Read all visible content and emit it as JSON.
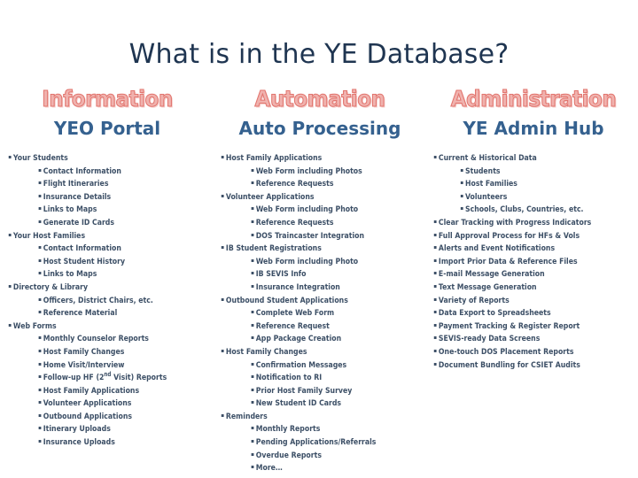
{
  "slide": {
    "title": "What is in the YE Database?"
  },
  "columns": [
    {
      "banner": "Information",
      "sub_header": "YEO Portal",
      "items": [
        {
          "level": 1,
          "text": "Your Students"
        },
        {
          "level": 2,
          "text": "Contact Information"
        },
        {
          "level": 2,
          "text": "Flight Itineraries"
        },
        {
          "level": 2,
          "text": "Insurance Details"
        },
        {
          "level": 2,
          "text": "Links to Maps"
        },
        {
          "level": 2,
          "text": "Generate ID Cards"
        },
        {
          "level": 1,
          "text": "Your Host Families"
        },
        {
          "level": 2,
          "text": "Contact Information"
        },
        {
          "level": 2,
          "text": "Host Student History"
        },
        {
          "level": 2,
          "text": "Links to Maps"
        },
        {
          "level": 1,
          "text": "Directory & Library"
        },
        {
          "level": 2,
          "text": "Officers, District Chairs, etc."
        },
        {
          "level": 2,
          "text": "Reference Material"
        },
        {
          "level": 1,
          "text": "Web Forms"
        },
        {
          "level": 2,
          "text": "Monthly Counselor Reports"
        },
        {
          "level": 2,
          "text": "Host Family Changes"
        },
        {
          "level": 2,
          "text": "Home Visit/Interview"
        },
        {
          "level": 2,
          "text": "Follow-up HF (2nd Visit) Reports",
          "superscript": {
            "before": "Follow-up HF (2",
            "sup": "nd",
            "after": " Visit) Reports"
          }
        },
        {
          "level": 2,
          "text": "Host Family Applications"
        },
        {
          "level": 2,
          "text": "Volunteer Applications"
        },
        {
          "level": 2,
          "text": "Outbound Applications"
        },
        {
          "level": 2,
          "text": "Itinerary Uploads"
        },
        {
          "level": 2,
          "text": "Insurance Uploads"
        }
      ]
    },
    {
      "banner": "Automation",
      "sub_header": "Auto Processing",
      "items": [
        {
          "level": 1,
          "text": "Host Family Applications"
        },
        {
          "level": 2,
          "text": "Web Form including Photos"
        },
        {
          "level": 2,
          "text": "Reference Requests"
        },
        {
          "level": 1,
          "text": "Volunteer Applications"
        },
        {
          "level": 2,
          "text": "Web Form including Photo"
        },
        {
          "level": 2,
          "text": "Reference Requests"
        },
        {
          "level": 2,
          "text": "DOS Traincaster Integration"
        },
        {
          "level": 1,
          "text": "IB Student Registrations"
        },
        {
          "level": 2,
          "text": "Web Form including Photo"
        },
        {
          "level": 2,
          "text": "IB SEVIS Info"
        },
        {
          "level": 2,
          "text": "Insurance Integration"
        },
        {
          "level": 1,
          "text": "Outbound Student Applications"
        },
        {
          "level": 2,
          "text": "Complete Web Form"
        },
        {
          "level": 2,
          "text": "Reference Request"
        },
        {
          "level": 2,
          "text": "App Package Creation"
        },
        {
          "level": 1,
          "text": "Host Family Changes"
        },
        {
          "level": 2,
          "text": "Confirmation Messages"
        },
        {
          "level": 2,
          "text": "Notification to RI"
        },
        {
          "level": 2,
          "text": "Prior Host Family Survey"
        },
        {
          "level": 2,
          "text": "New Student ID Cards"
        },
        {
          "level": 1,
          "text": "Reminders"
        },
        {
          "level": 2,
          "text": "Monthly Reports"
        },
        {
          "level": 2,
          "text": "Pending Applications/Referrals"
        },
        {
          "level": 2,
          "text": "Overdue Reports"
        },
        {
          "level": 2,
          "text": "More…"
        }
      ]
    },
    {
      "banner": "Administration",
      "sub_header": "YE Admin Hub",
      "items": [
        {
          "level": 1,
          "text": "Current & Historical Data"
        },
        {
          "level": 2,
          "text": "Students"
        },
        {
          "level": 2,
          "text": "Host Families"
        },
        {
          "level": 2,
          "text": "Volunteers"
        },
        {
          "level": 2,
          "text": "Schools, Clubs, Countries, etc."
        },
        {
          "level": 1,
          "text": "Clear Tracking with Progress Indicators"
        },
        {
          "level": 1,
          "text": "Full Approval Process for HFs & Vols"
        },
        {
          "level": 1,
          "text": "Alerts and Event Notifications"
        },
        {
          "level": 1,
          "text": "Import Prior Data & Reference Files"
        },
        {
          "level": 1,
          "text": "E-mail Message Generation"
        },
        {
          "level": 1,
          "text": "Text Message Generation"
        },
        {
          "level": 1,
          "text": "Variety of Reports"
        },
        {
          "level": 1,
          "text": "Data Export to Spreadsheets"
        },
        {
          "level": 1,
          "text": "Payment Tracking & Register Report"
        },
        {
          "level": 1,
          "text": "SEVIS-ready Data Screens"
        },
        {
          "level": 1,
          "text": "One-touch DOS Placement Reports"
        },
        {
          "level": 1,
          "text": "Document Bundling for CSIET Audits"
        }
      ]
    }
  ],
  "theme": {
    "title_color": "#1f3551",
    "banner_fill": "#f0b2ae",
    "banner_outline": "#e2756e",
    "sub_header_color": "#35618f",
    "body_color": "#3c4f66",
    "background": "#ffffff"
  }
}
